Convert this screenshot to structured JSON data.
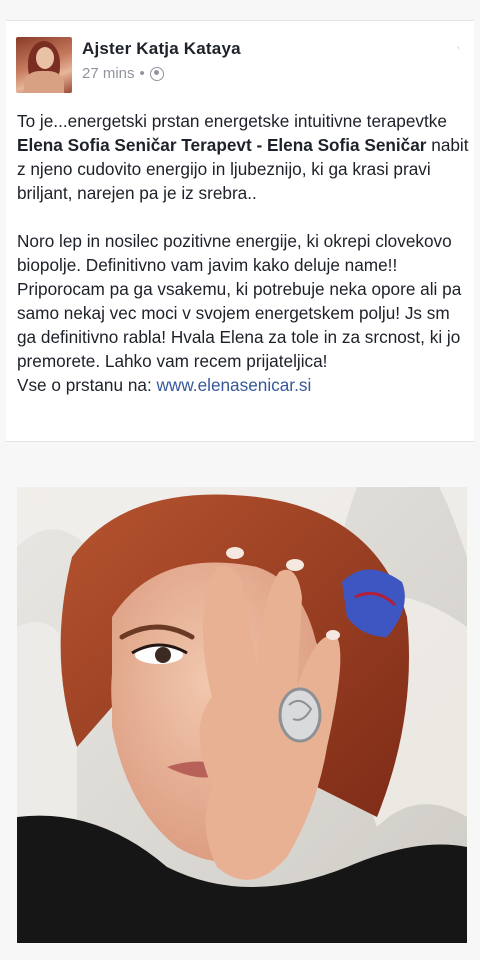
{
  "post": {
    "author_name": "Ajster Katja Kataya",
    "time": "27 mins",
    "separator": "•",
    "privacy_icon": "globe-icon",
    "menu_icon": "chevron-down-icon",
    "paragraph1": {
      "part1": "To je...energetski prstan energetske intuitivne terapevtke ",
      "bold": "Elena Sofia Seničar Terapevt - Elena Sofia Seničar",
      "part2": " nabit z njeno cudovito energijo in ljubeznijo, ki ga krasi pravi briljant, narejen pa je iz srebra.."
    },
    "paragraph2": "Noro lep in nosilec pozitivne energije,  ki okrepi clovekovo biopolje. Definitivno vam javim kako deluje name!! Priporocam pa ga vsakemu,  ki potrebuje neka opore ali pa samo nekaj vec moci v svojem energetskem polju! Js sm ga definitivno rabla! Hvala Elena za tole in za srcnost,  ki jo premorete. Lahko vam recem prijateljica!",
    "link_prefix": "Vse o prstanu na: ",
    "link_text": "www.elenasenicar.si"
  },
  "photo": {
    "subject": "woman-covering-eye-with-hand-wearing-silver-ring"
  },
  "colors": {
    "text": "#1d2129",
    "meta": "#90949c",
    "link": "#365899",
    "background": "#f7f7f7"
  }
}
